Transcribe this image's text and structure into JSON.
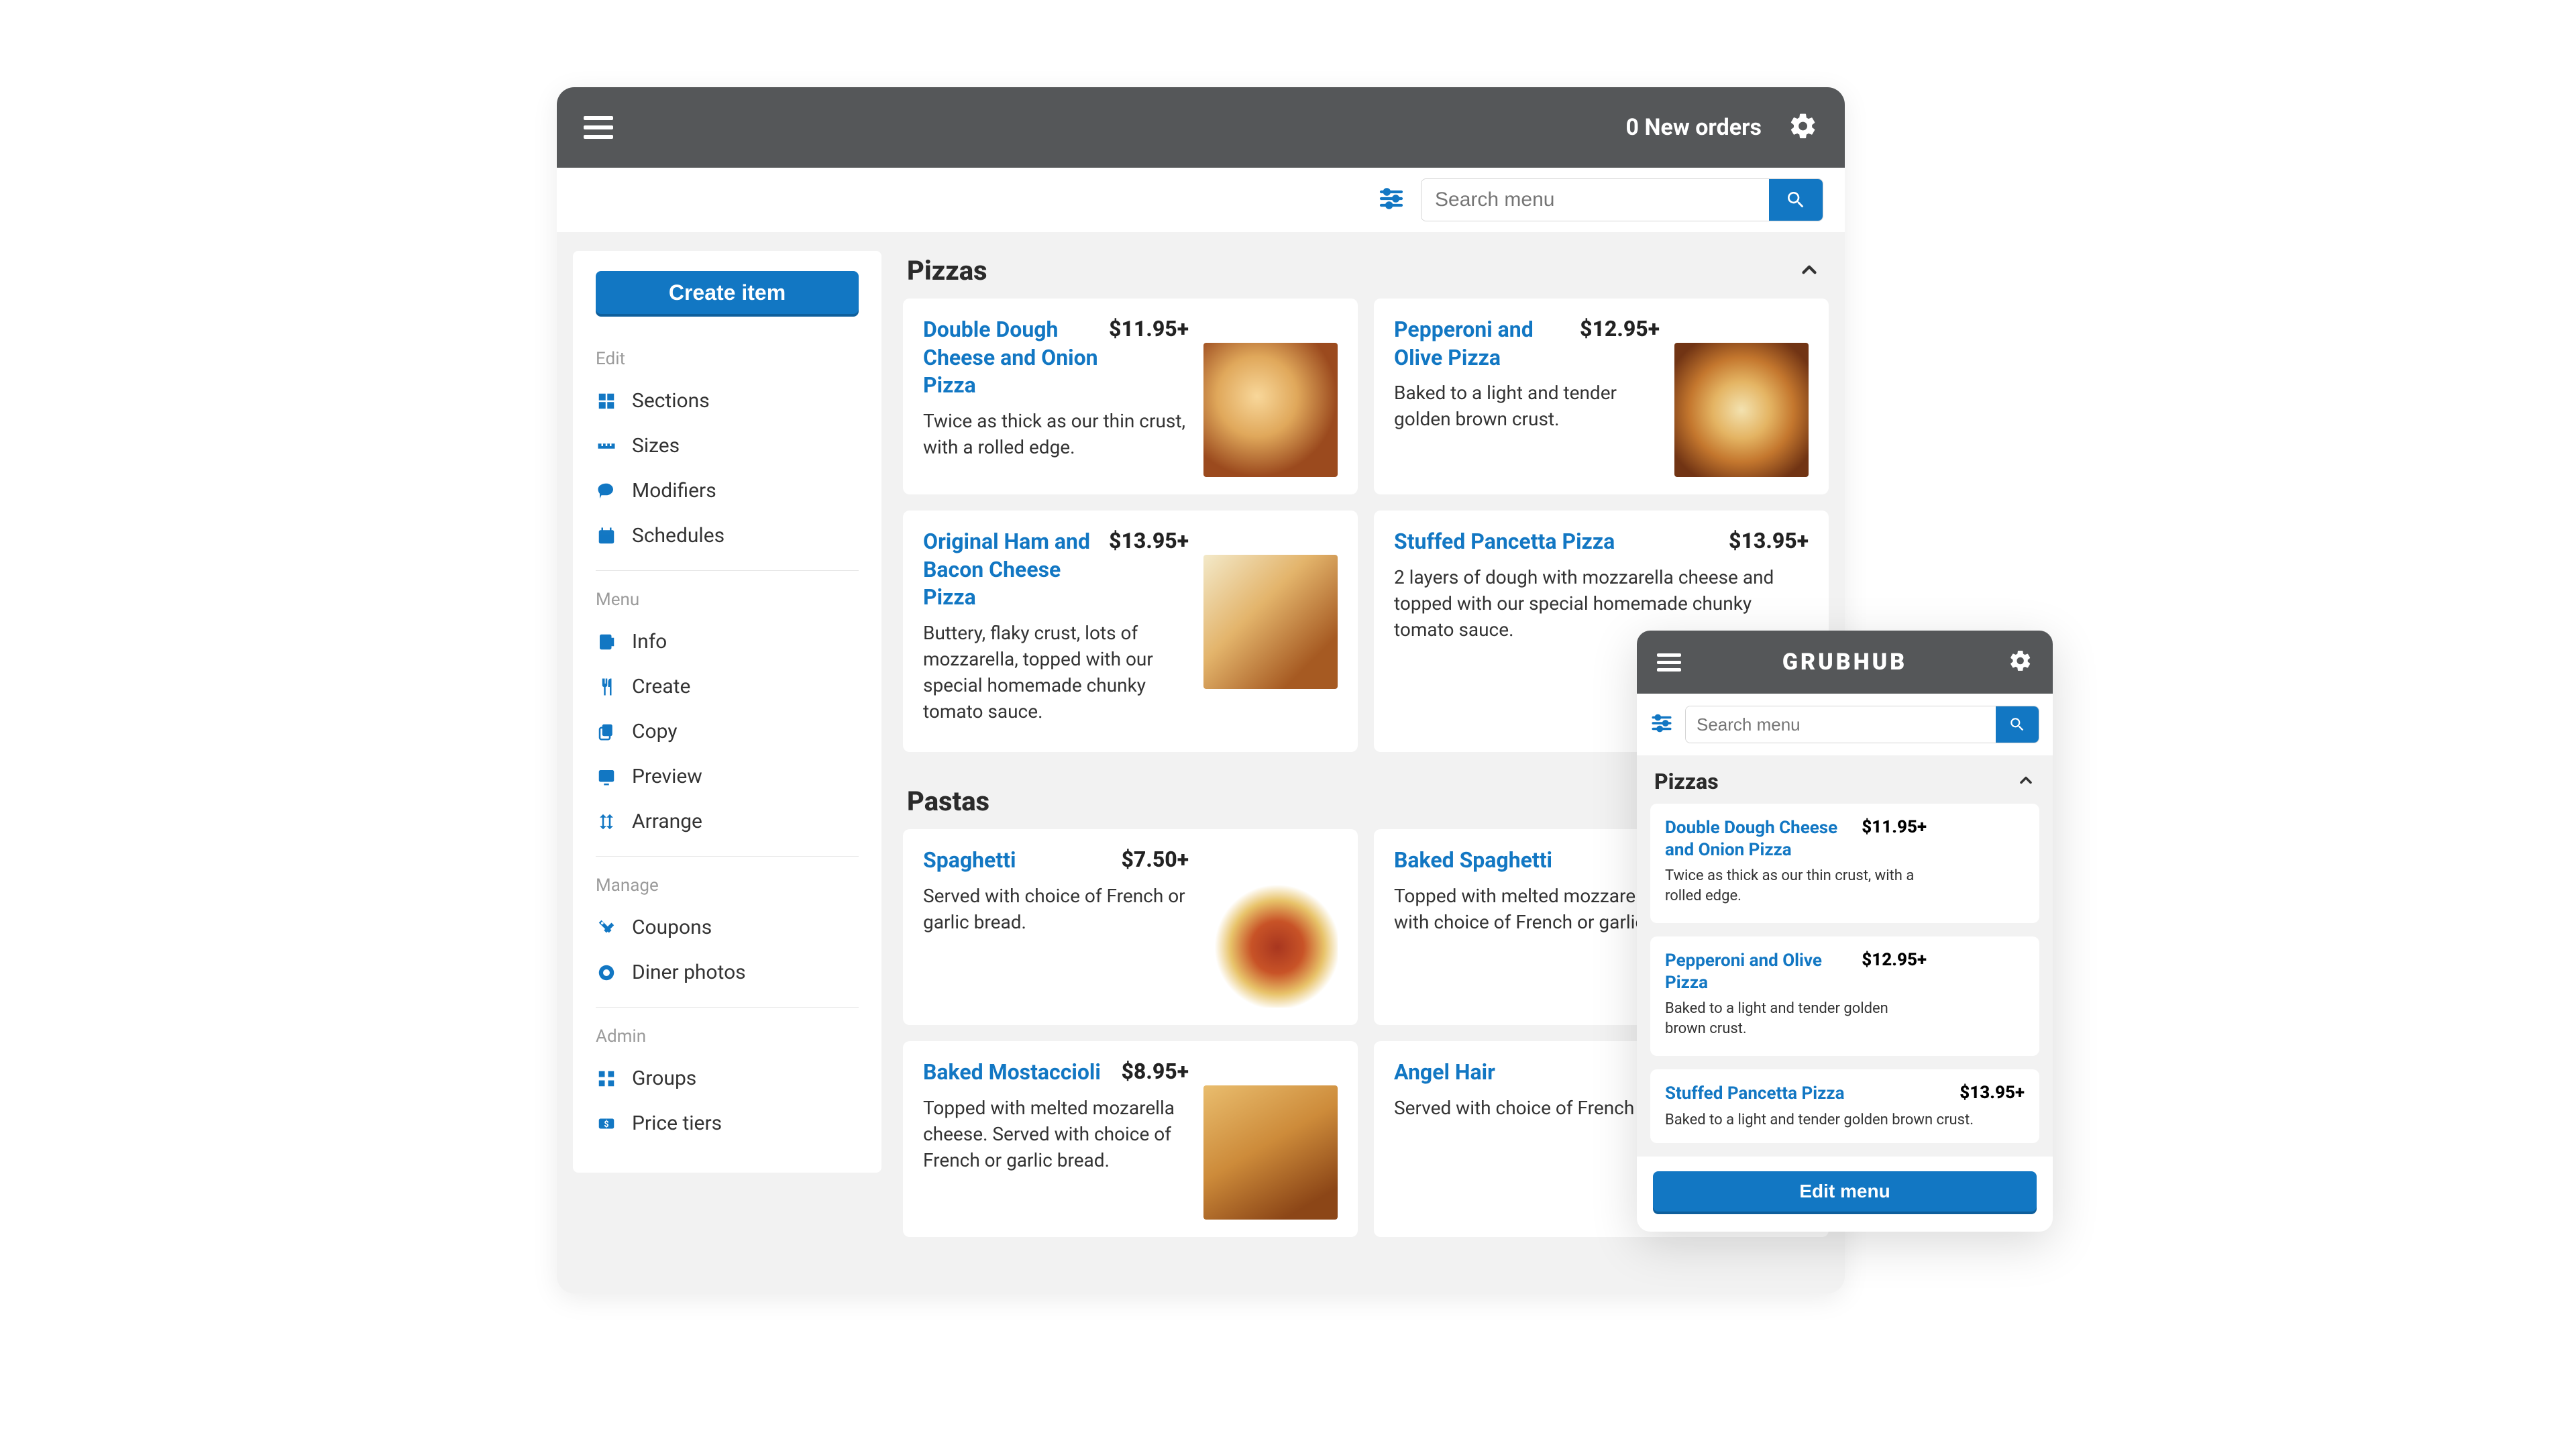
{
  "header": {
    "orders_text": "0 New orders"
  },
  "search": {
    "placeholder": "Search menu"
  },
  "sidebar": {
    "create_label": "Create item",
    "groups": [
      {
        "label": "Edit",
        "items": [
          {
            "icon": "sections-icon",
            "label": "Sections"
          },
          {
            "icon": "sizes-icon",
            "label": "Sizes"
          },
          {
            "icon": "modifiers-icon",
            "label": "Modifiers"
          },
          {
            "icon": "schedules-icon",
            "label": "Schedules"
          }
        ]
      },
      {
        "label": "Menu",
        "items": [
          {
            "icon": "info-icon",
            "label": "Info"
          },
          {
            "icon": "create-icon",
            "label": "Create"
          },
          {
            "icon": "copy-icon",
            "label": "Copy"
          },
          {
            "icon": "preview-icon",
            "label": "Preview"
          },
          {
            "icon": "arrange-icon",
            "label": "Arrange"
          }
        ]
      },
      {
        "label": "Manage",
        "items": [
          {
            "icon": "coupons-icon",
            "label": "Coupons"
          },
          {
            "icon": "photos-icon",
            "label": "Diner photos"
          }
        ]
      },
      {
        "label": "Admin",
        "items": [
          {
            "icon": "groups-icon",
            "label": "Groups"
          },
          {
            "icon": "tiers-icon",
            "label": "Price tiers"
          }
        ]
      }
    ]
  },
  "sections": [
    {
      "title": "Pizzas",
      "items": [
        {
          "name": "Double Dough Cheese and Onion Pizza",
          "price": "$11.95+",
          "desc": "Twice as thick as our thin crust, with a rolled edge.",
          "thumb": "pizza1"
        },
        {
          "name": "Pepperoni and Olive Pizza",
          "price": "$12.95+",
          "desc": "Baked to a light and tender golden brown crust.",
          "thumb": "pizza2"
        },
        {
          "name": "Original Ham and Bacon Cheese Pizza",
          "price": "$13.95+",
          "desc": "Buttery, flaky crust, lots of mozzarella, topped with our special homemade chunky tomato sauce.",
          "thumb": "pizza3"
        },
        {
          "name": "Stuffed Pancetta Pizza",
          "price": "$13.95+",
          "desc": "2 layers of dough with mozzarella cheese and topped with our special homemade chunky tomato sauce.",
          "thumb": ""
        }
      ]
    },
    {
      "title": "Pastas",
      "items": [
        {
          "name": "Spaghetti",
          "price": "$7.50+",
          "desc": "Served with choice of French or garlic bread.",
          "thumb": "pasta1"
        },
        {
          "name": "Baked Spaghetti",
          "price": "",
          "desc": "Topped with melted mozzarella cheese. Served with choice of French or garlic bread.",
          "thumb": ""
        },
        {
          "name": "Baked Mostaccioli",
          "price": "$8.95+",
          "desc": "Topped with melted mozarella cheese. Served with choice of French or garlic bread.",
          "thumb": "pasta2"
        },
        {
          "name": "Angel Hair",
          "price": "",
          "desc": "Served with choice of French or garlic bread.",
          "thumb": ""
        }
      ]
    }
  ],
  "mobile": {
    "logo": "GRUBHUB",
    "search_placeholder": "Search menu",
    "section_title": "Pizzas",
    "items": [
      {
        "name": "Double Dough Cheese and Onion Pizza",
        "price": "$11.95+",
        "desc": "Twice as thick as our thin crust, with a rolled edge.",
        "thumb": "pizza1"
      },
      {
        "name": "Pepperoni and Olive Pizza",
        "price": "$12.95+",
        "desc": "Baked to a light and tender golden brown crust.",
        "thumb": "pizza2"
      },
      {
        "name": "Stuffed Pancetta Pizza",
        "price": "$13.95+",
        "desc": "Baked to a light and tender golden brown crust.",
        "thumb": ""
      }
    ],
    "edit_label": "Edit menu"
  }
}
